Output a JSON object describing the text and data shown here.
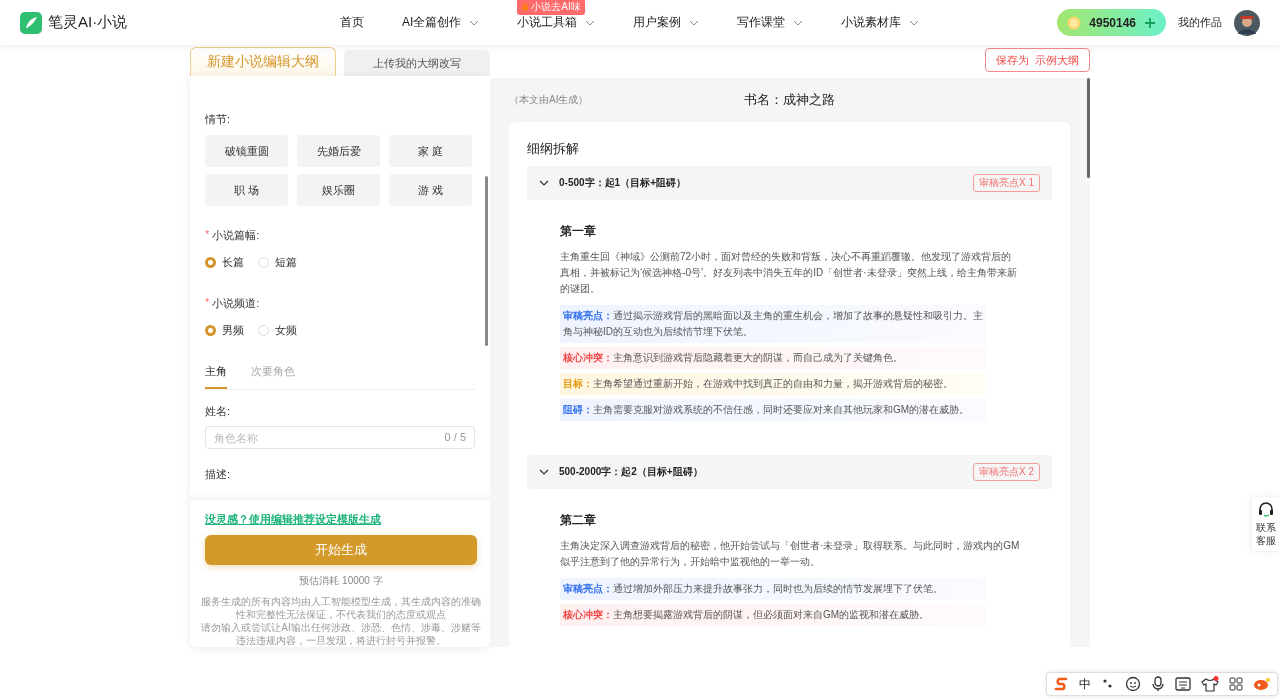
{
  "header": {
    "logo_text": "笔灵AI·小说",
    "nav": [
      {
        "label": "首页",
        "dropdown": false
      },
      {
        "label": "AI全篇创作",
        "dropdown": true
      },
      {
        "label": "小说工具箱",
        "dropdown": true,
        "badge": "小说去AI味"
      },
      {
        "label": "用户案例",
        "dropdown": true
      },
      {
        "label": "写作课堂",
        "dropdown": true
      },
      {
        "label": "小说素材库",
        "dropdown": true
      }
    ],
    "coins": "4950146",
    "my_works": "我的作品"
  },
  "mode_tabs": [
    {
      "label": "新建小说编辑大纲",
      "selected": true
    },
    {
      "label": "上传我的大纲改写",
      "selected": false
    }
  ],
  "save_button": "保存为  示例大纲",
  "form": {
    "required_mark": "*",
    "plot_label": "情节:",
    "plots": [
      {
        "label": "破镜重圆",
        "selected": false
      },
      {
        "label": "先婚后爱",
        "selected": false
      },
      {
        "label": "家 庭",
        "selected": false
      },
      {
        "label": "职 场",
        "selected": false
      },
      {
        "label": "娱乐圈",
        "selected": false
      },
      {
        "label": "游 戏",
        "selected": false
      }
    ],
    "groups": [
      {
        "label": "小说篇幅:",
        "required": true,
        "options": [
          {
            "label": "长篇",
            "selected": true
          },
          {
            "label": "短篇",
            "selected": false
          }
        ]
      },
      {
        "label": "小说频道:",
        "required": true,
        "options": [
          {
            "label": "男频",
            "selected": true
          },
          {
            "label": "女频",
            "selected": false
          }
        ]
      }
    ],
    "role_tabs": [
      {
        "label": "主角",
        "selected": true
      },
      {
        "label": "次要角色",
        "selected": false
      }
    ],
    "name_label": "姓名:",
    "name_placeholder": "角色名称",
    "name_counter": "0 / 5",
    "desc_label": "描述:"
  },
  "footer": {
    "link": "没灵感？使用编辑推荐设定模版生成",
    "button": "开始生成",
    "estimate": "预估消耗 10000 字",
    "disclaimer": [
      "服务生成的所有内容均由人工智能模型生成，其生成内容的准确性和完整性无法保证，不代表我们的态度或观点",
      "请勿输入或尝试让AI输出任何涉政、涉恐、色情、涉毒、涉赌等违法违规内容，一旦发现，将进行封号并报警。"
    ]
  },
  "outline": {
    "note": "（本文由AI生成）",
    "book_title": "书名：成神之路",
    "heading": "细纲拆解",
    "sections": [
      {
        "title": "0-500字：起1（目标+阻碍）",
        "badge": "审稿亮点X 1",
        "expanded": true,
        "chapter": "第一章",
        "summary": "主角重生回《神域》公测前72小时，面对曾经的失败和背叛，决心不再重蹈覆辙。他发现了游戏背后的真相，并被标记为‘候选神格-0号’。好友列表中消失五年的ID「创世者·未登录」突然上线，给主角带来新的谜团。",
        "notes": [
          {
            "kind": "highlight",
            "text": "**审稿亮点：**通过揭示游戏背后的黑暗面以及主角的重生机会，增加了故事的悬疑性和吸引力。主角与神秘ID的互动也为后续情节埋下伏笔。"
          },
          {
            "kind": "conflict",
            "text": "**核心冲突：**主角意识到游戏背后隐藏着更大的阴谋，而自己成为了关键角色。"
          },
          {
            "kind": "goal",
            "text": "**目标：**主角希望通过重新开始，在游戏中找到真正的自由和力量，揭开游戏背后的秘密。"
          },
          {
            "kind": "obstacle",
            "text": "**阻碍：**主角需要克服对游戏系统的不信任感，同时还要应对来自其他玩家和GM的潜在威胁。"
          }
        ]
      },
      {
        "title": "500-2000字：起2（目标+阻碍）",
        "badge": "审稿亮点X 2",
        "expanded": true,
        "chapter": "第二章",
        "summary": "主角决定深入调查游戏背后的秘密，他开始尝试与「创世者·未登录」取得联系。与此同时，游戏内的GM似乎注意到了他的异常行为，开始暗中监视他的一举一动。",
        "notes": [
          {
            "kind": "highlight",
            "text": "**审稿亮点：**通过增加外部压力来提升故事张力，同时也为后续的情节发展埋下了伏笔。"
          },
          {
            "kind": "conflict",
            "text": "**核心冲突：**主角想要揭露游戏背后的阴谋，但必须面对来自GM的监视和潜在威胁。"
          }
        ]
      }
    ]
  },
  "support": "联系客服",
  "ime": {
    "mode": "中"
  }
}
